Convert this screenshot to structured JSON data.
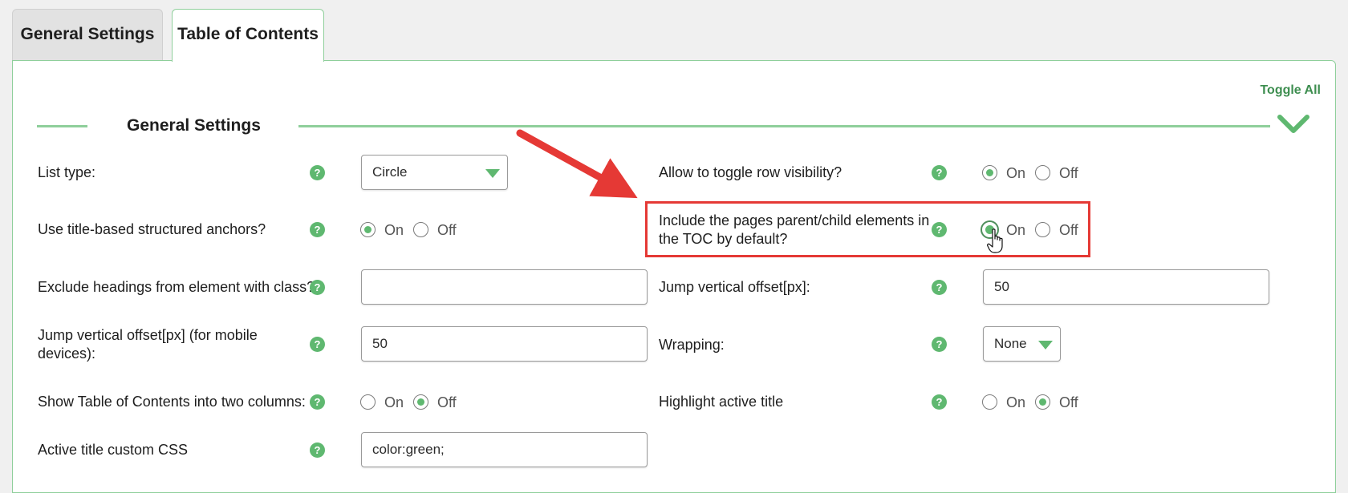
{
  "tabs": {
    "general": "General Settings",
    "toc": "Table of Contents"
  },
  "toggle_all": "Toggle All",
  "section": {
    "title": "General Settings"
  },
  "help_glyph": "?",
  "radio": {
    "on": "On",
    "off": "Off"
  },
  "left": {
    "list_type": {
      "label": "List type:",
      "value": "Circle"
    },
    "title_anchors": {
      "label": "Use title-based structured anchors?",
      "state": "On"
    },
    "exclude_headings": {
      "label": "Exclude headings from element with class?",
      "value": ""
    },
    "jump_offset_mobile": {
      "label_line1": "Jump vertical offset[px] (for mobile",
      "label_line2": "devices):",
      "value": "50"
    },
    "two_columns": {
      "label": "Show Table of Contents into two columns:",
      "state": "Off"
    },
    "active_css": {
      "label": "Active title custom CSS",
      "value": "color:green;"
    }
  },
  "right": {
    "toggle_row": {
      "label": "Allow to toggle row visibility?",
      "state": "On"
    },
    "parent_child": {
      "label_line1": "Include the pages parent/child elements in",
      "label_line2": "the TOC by default?",
      "state": "On"
    },
    "jump_offset": {
      "label": "Jump vertical offset[px]:",
      "value": "50"
    },
    "wrapping": {
      "label": "Wrapping:",
      "value": "None"
    },
    "highlight_active": {
      "label": "Highlight active title",
      "state": "Off"
    }
  },
  "colors": {
    "accent": "#5fb870",
    "annotation": "#e53935",
    "border": "#8fcf9b"
  }
}
